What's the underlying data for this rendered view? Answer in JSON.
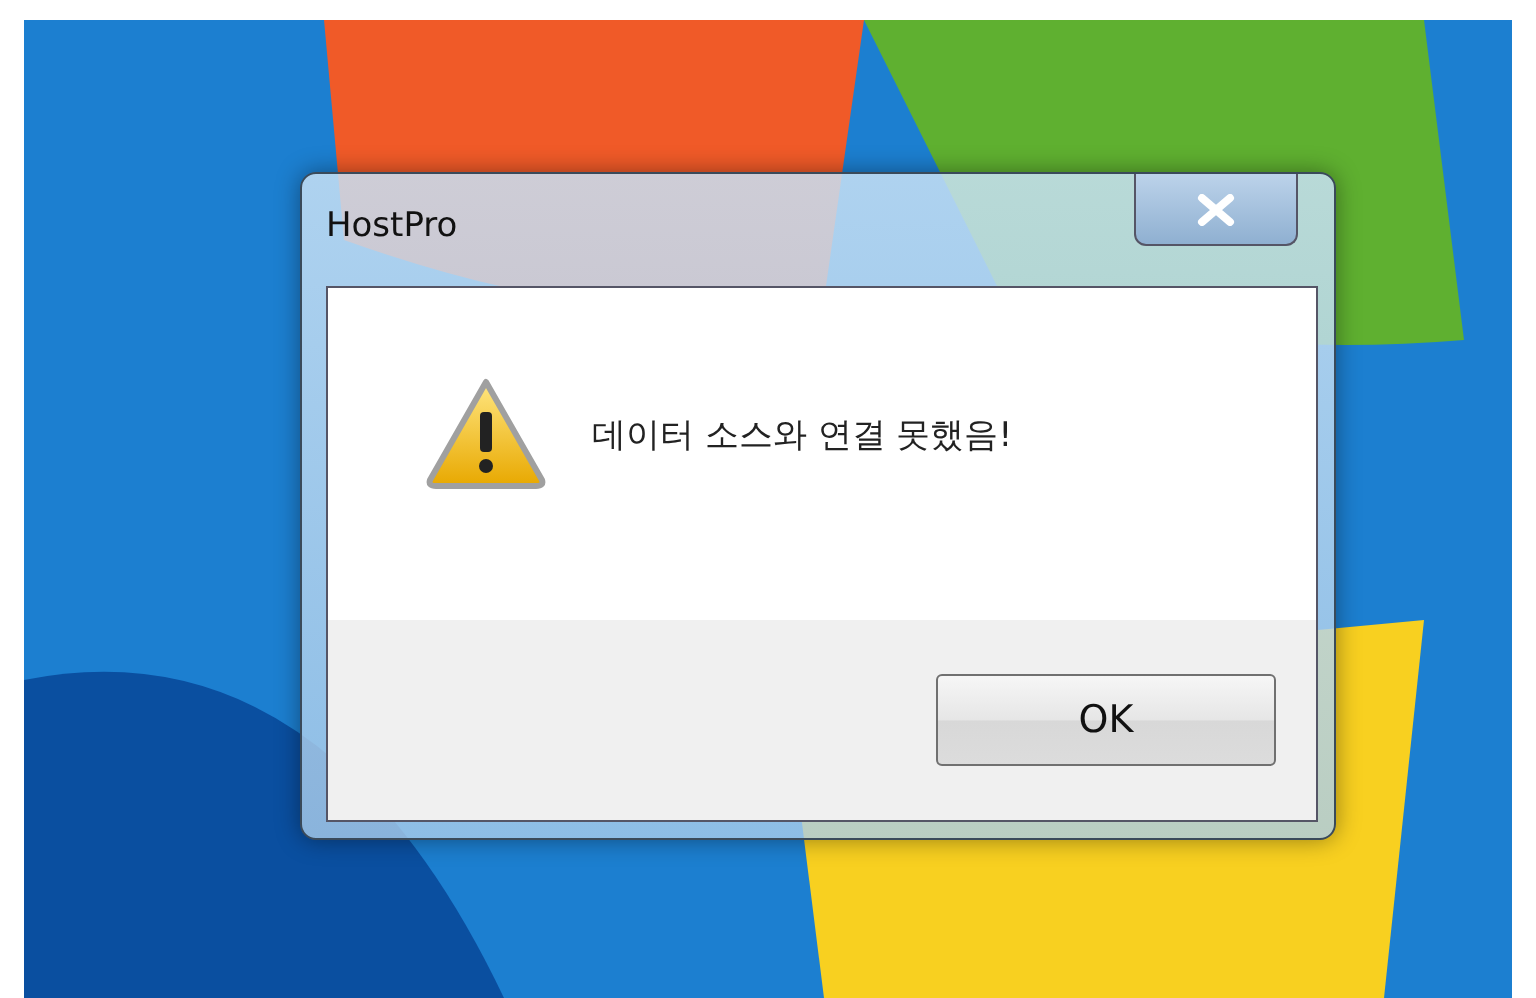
{
  "window": {
    "title": "HostPro"
  },
  "message": {
    "kind": "warning",
    "text": "데이터 소스와 연결 못했음!"
  },
  "buttons": [
    {
      "label": "OK"
    }
  ]
}
